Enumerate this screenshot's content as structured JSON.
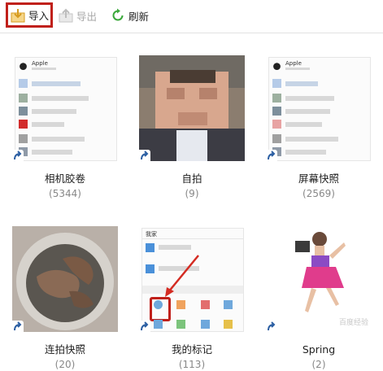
{
  "toolbar": {
    "import_label": "导入",
    "export_label": "导出",
    "refresh_label": "刷新"
  },
  "albums": [
    {
      "name": "相机胶卷",
      "count": "(5344)"
    },
    {
      "name": "自拍",
      "count": "(9)"
    },
    {
      "name": "屏幕快照",
      "count": "(2569)"
    },
    {
      "name": "连拍快照",
      "count": "(20)"
    },
    {
      "name": "我的标记",
      "count": "(113)"
    },
    {
      "name": "Spring",
      "count": "(2)"
    }
  ],
  "thumb_text": {
    "apple": "Apple",
    "mine": "我家"
  },
  "watermark": "百度经验",
  "colors": {
    "highlight_border": "#c0201a",
    "refresh_green": "#3aa83a",
    "import_yellow": "#e8b73a"
  }
}
